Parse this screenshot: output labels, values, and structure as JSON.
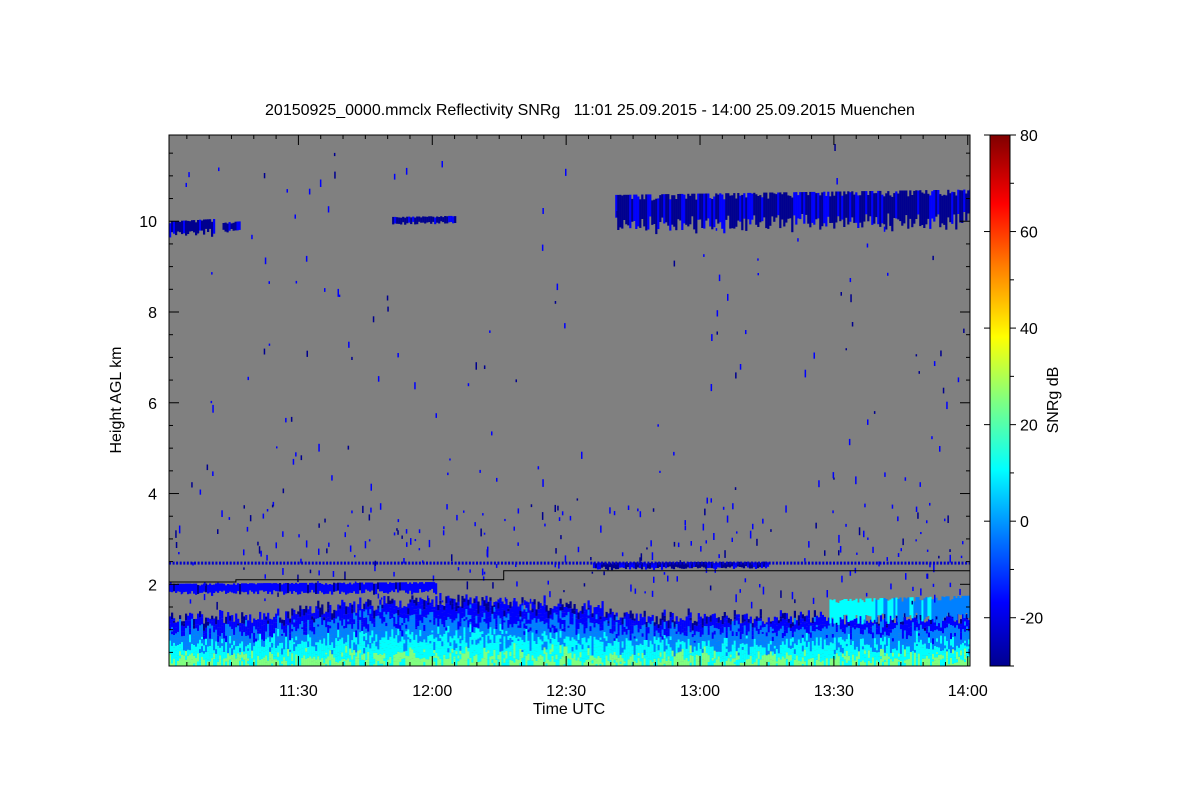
{
  "chart_data": {
    "type": "heatmap",
    "title": "20150925_0000.mmclx Reflectivity SNRg   11:01 25.09.2015 - 14:00 25.09.2015 Muenchen",
    "xlabel": "Time UTC",
    "ylabel": "Height AGL km",
    "x_ticks": [
      "11:30",
      "12:00",
      "12:30",
      "13:00",
      "13:30",
      "14:00"
    ],
    "x_tick_minutes": [
      30,
      60,
      90,
      120,
      150,
      180
    ],
    "x_range_minutes": [
      1,
      180.5
    ],
    "y_ticks": [
      2,
      4,
      6,
      8,
      10
    ],
    "y_range_km": [
      0.2,
      11.9
    ],
    "background_color": "#808080",
    "colorbar": {
      "label": "SNRg dB",
      "ticks": [
        -20,
        0,
        20,
        40,
        60,
        80
      ],
      "range": [
        -30,
        80
      ],
      "colormap": [
        "#00008f",
        "#0000ff",
        "#0080ff",
        "#00ffff",
        "#80ff80",
        "#ffff00",
        "#ff8000",
        "#ff0000",
        "#800000"
      ]
    },
    "features": [
      {
        "name": "cirrus",
        "x_minutes": [
          1,
          11
        ],
        "height_km": [
          9.7,
          10.05
        ],
        "snr_db": -25
      },
      {
        "name": "cirrus",
        "x_minutes": [
          13,
          17
        ],
        "height_km": [
          9.8,
          10.0
        ],
        "snr_db": -25
      },
      {
        "name": "cirrus",
        "x_minutes": [
          51,
          65
        ],
        "height_km": [
          9.95,
          10.12
        ],
        "snr_db": -25
      },
      {
        "name": "cirrus",
        "x_minutes": [
          101,
          180.5
        ],
        "height_km": [
          9.9,
          10.7
        ],
        "snr_db": -24
      },
      {
        "name": "layer",
        "x_minutes": [
          1,
          61
        ],
        "height_km": [
          1.8,
          2.05
        ],
        "snr_db": -20
      },
      {
        "name": "layer",
        "x_minutes": [
          96,
          135
        ],
        "height_km": [
          2.35,
          2.5
        ],
        "snr_db": -24
      },
      {
        "name": "layer",
        "x_minutes": [
          149,
          180.5
        ],
        "height_km": [
          1.2,
          1.75
        ],
        "snr_db": 0
      },
      {
        "name": "boundary-layer",
        "x_minutes": [
          1,
          180.5
        ],
        "height_km": [
          0.2,
          1.6
        ],
        "snr_db": 5
      }
    ],
    "threshold_line": {
      "x_minutes": [
        1,
        16,
        16,
        76,
        76,
        180.5
      ],
      "height_km": [
        2.05,
        2.05,
        2.1,
        2.1,
        2.3,
        2.3
      ]
    }
  }
}
